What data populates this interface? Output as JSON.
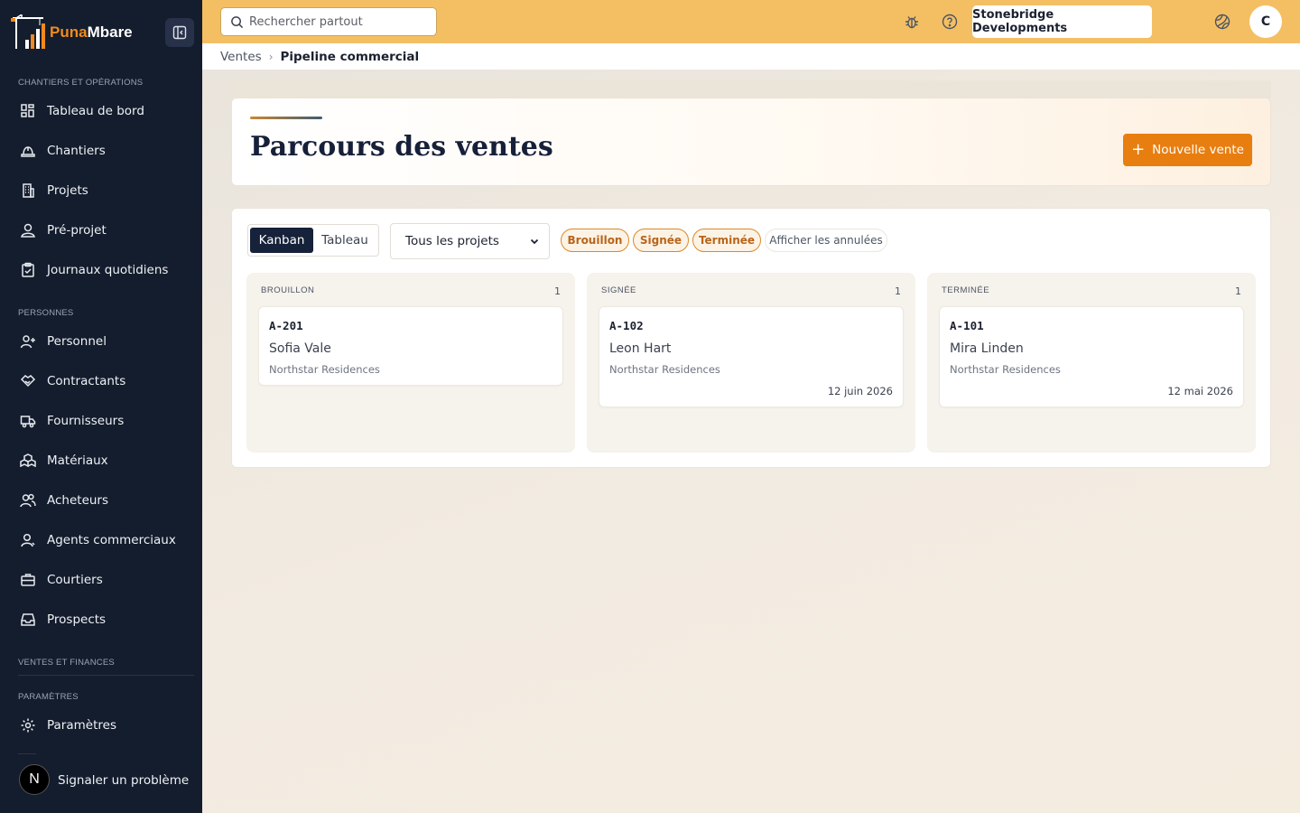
{
  "brand": {
    "name_a": "Puna",
    "name_b": "Mbare"
  },
  "sidebar": {
    "sections": [
      {
        "label": "CHANTIERS ET OPÉRATIONS"
      },
      {
        "label": "PERSONNES"
      },
      {
        "label": "VENTES ET FINANCES"
      },
      {
        "label": "PARAMÈTRES"
      }
    ],
    "items": [
      {
        "label": "Tableau de bord"
      },
      {
        "label": "Chantiers"
      },
      {
        "label": "Projets"
      },
      {
        "label": "Pré-projet"
      },
      {
        "label": "Journaux quotidiens"
      },
      {
        "label": "Personnel"
      },
      {
        "label": "Contractants"
      },
      {
        "label": "Fournisseurs"
      },
      {
        "label": "Matériaux"
      },
      {
        "label": "Acheteurs"
      },
      {
        "label": "Agents commerciaux"
      },
      {
        "label": "Courtiers"
      },
      {
        "label": "Prospects"
      },
      {
        "label": "Paramètres"
      },
      {
        "label": "Signaler un problème"
      }
    ],
    "badge": "N"
  },
  "header": {
    "search_placeholder": "Rechercher partout",
    "company": "Stonebridge Developments",
    "avatar": "C"
  },
  "breadcrumb": {
    "parent": "Ventes",
    "current": "Pipeline commercial"
  },
  "page": {
    "title": "Parcours des ventes",
    "new_button": "Nouvelle vente"
  },
  "board": {
    "view_kanban": "Kanban",
    "view_table": "Tableau",
    "project_filter": "Tous les projets",
    "chips": [
      "Brouillon",
      "Signée",
      "Terminée"
    ],
    "show_cancelled": "Afficher les annulées",
    "columns": [
      {
        "title": "BROUILLON",
        "count": "1",
        "card": {
          "code": "A-201",
          "name": "Sofia Vale",
          "project": "Northstar Residences",
          "date": ""
        }
      },
      {
        "title": "SIGNÉE",
        "count": "1",
        "card": {
          "code": "A-102",
          "name": "Leon Hart",
          "project": "Northstar Residences",
          "date": "12 juin 2026"
        }
      },
      {
        "title": "TERMINÉE",
        "count": "1",
        "card": {
          "code": "A-101",
          "name": "Mira Linden",
          "project": "Northstar Residences",
          "date": "12 mai 2026"
        }
      }
    ]
  }
}
